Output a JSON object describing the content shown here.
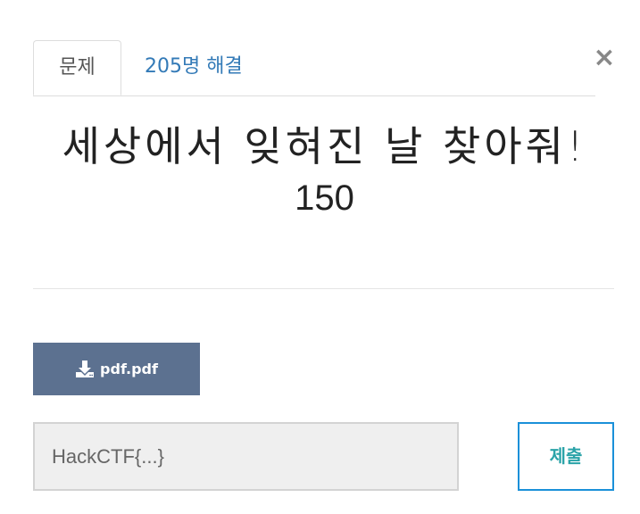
{
  "modal": {
    "close_symbol": "×",
    "tabs": [
      {
        "label": "문제"
      },
      {
        "label": "205명 해결"
      }
    ],
    "challenge": {
      "title": "세상에서 잊혀진 날 찾아줘!",
      "points": "150"
    },
    "download": {
      "icon": "download-icon",
      "label": "pdf.pdf"
    },
    "submission": {
      "placeholder": "HackCTF{...}",
      "value": "",
      "submit_label": "제출"
    }
  },
  "colors": {
    "download_button_bg": "#5c7190",
    "tab_link": "#337ab7",
    "submit_border": "#1a90d9",
    "submit_text": "#2aa3a8"
  }
}
